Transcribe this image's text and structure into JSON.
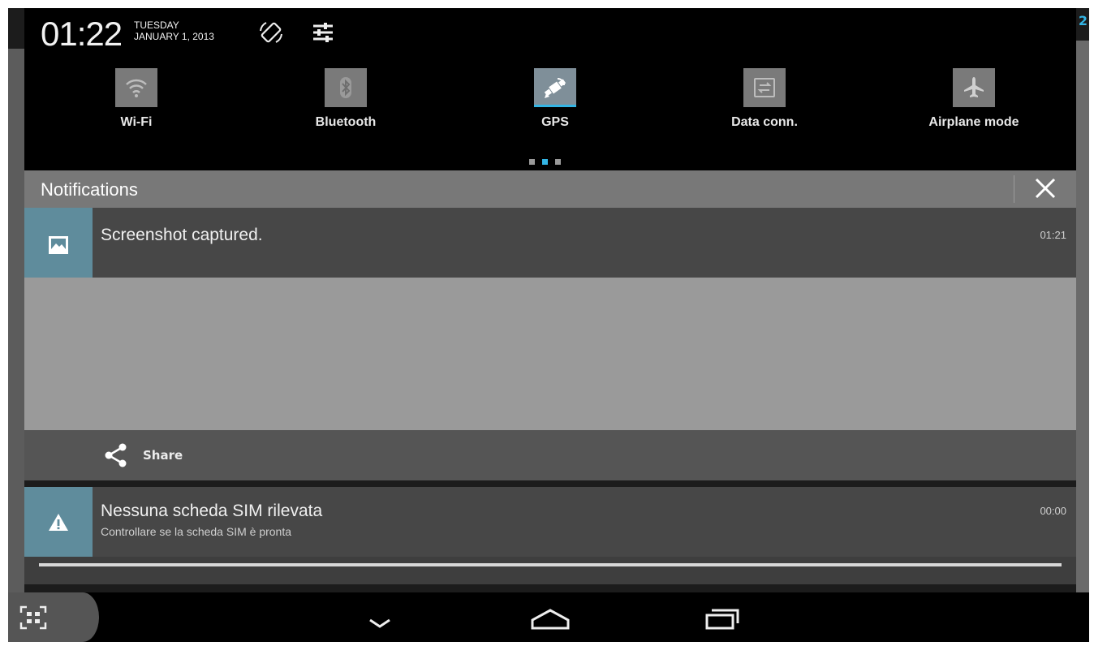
{
  "status": {
    "time": "01:22",
    "weekday": "TUESDAY",
    "date": "JANUARY 1, 2013",
    "corner_digit": "2"
  },
  "quick_settings": [
    {
      "label": "Wi-Fi",
      "icon": "wifi-icon",
      "active": false
    },
    {
      "label": "Bluetooth",
      "icon": "bluetooth-icon",
      "active": false
    },
    {
      "label": "GPS",
      "icon": "gps-icon",
      "active": true
    },
    {
      "label": "Data conn.",
      "icon": "data-connection-icon",
      "active": false
    },
    {
      "label": "Airplane mode",
      "icon": "airplane-icon",
      "active": false
    }
  ],
  "pager": {
    "pages": 3,
    "current": 2
  },
  "notifications_header": {
    "title": "Notifications"
  },
  "notifications": [
    {
      "title": "Screenshot captured.",
      "time": "01:21",
      "icon": "image-icon",
      "action": {
        "label": "Share",
        "icon": "share-icon"
      }
    },
    {
      "title": "Nessuna scheda SIM rilevata",
      "subtitle": "Controllare se la scheda SIM è pronta",
      "time": "00:00",
      "icon": "warning-icon"
    }
  ],
  "colors": {
    "accent": "#33b5e5",
    "notif_icon_bg": "#5f8c9c",
    "header_bg": "#000000",
    "notif_bar_bg": "#787878"
  },
  "navigation": [
    "back-icon",
    "home-icon",
    "recent-apps-icon"
  ]
}
